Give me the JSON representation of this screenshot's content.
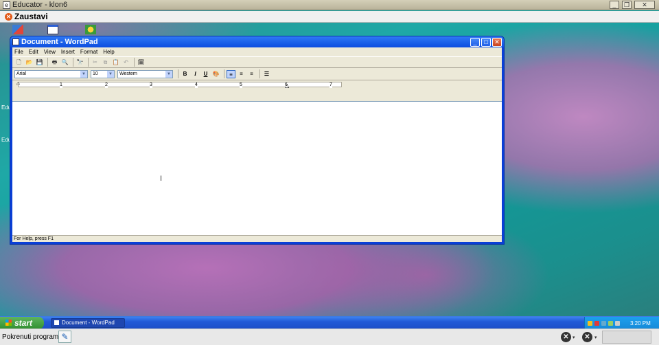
{
  "outer_window": {
    "title": "Educator - klon6",
    "icon": "educator-app-icon",
    "controls": [
      "minimize-icon",
      "restore-icon",
      "close-icon"
    ]
  },
  "toolbar_top": {
    "stop_label": "Zaustavi",
    "stop_icon": "stop-icon"
  },
  "side_labels": [
    "Edu",
    "Edu"
  ],
  "wordpad": {
    "title": "Document - WordPad",
    "menu": [
      "File",
      "Edit",
      "View",
      "Insert",
      "Format",
      "Help"
    ],
    "toolbar_icons": [
      "new-icon",
      "open-icon",
      "save-icon",
      "print-icon",
      "print-preview-icon",
      "find-icon",
      "cut-icon",
      "copy-icon",
      "paste-icon",
      "undo-icon",
      "date-time-icon"
    ],
    "font": "Arial",
    "size": "10",
    "script": "Western",
    "format_buttons": {
      "bold": "B",
      "italic": "I",
      "underline": "U"
    },
    "ruler_numbers": [
      "1",
      "2",
      "3",
      "4",
      "5",
      "6",
      "7"
    ],
    "status": "For Help, press F1"
  },
  "taskbar": {
    "start_label": "start",
    "task_label": "Document - WordPad",
    "clock": "3:20 PM"
  },
  "bottom_bar": {
    "label": "Pokrenuti programi:"
  },
  "colors": {
    "xp_blue": "#0a3fd6",
    "start_green": "#3c9a3c",
    "stop_orange": "#e25b1a"
  }
}
